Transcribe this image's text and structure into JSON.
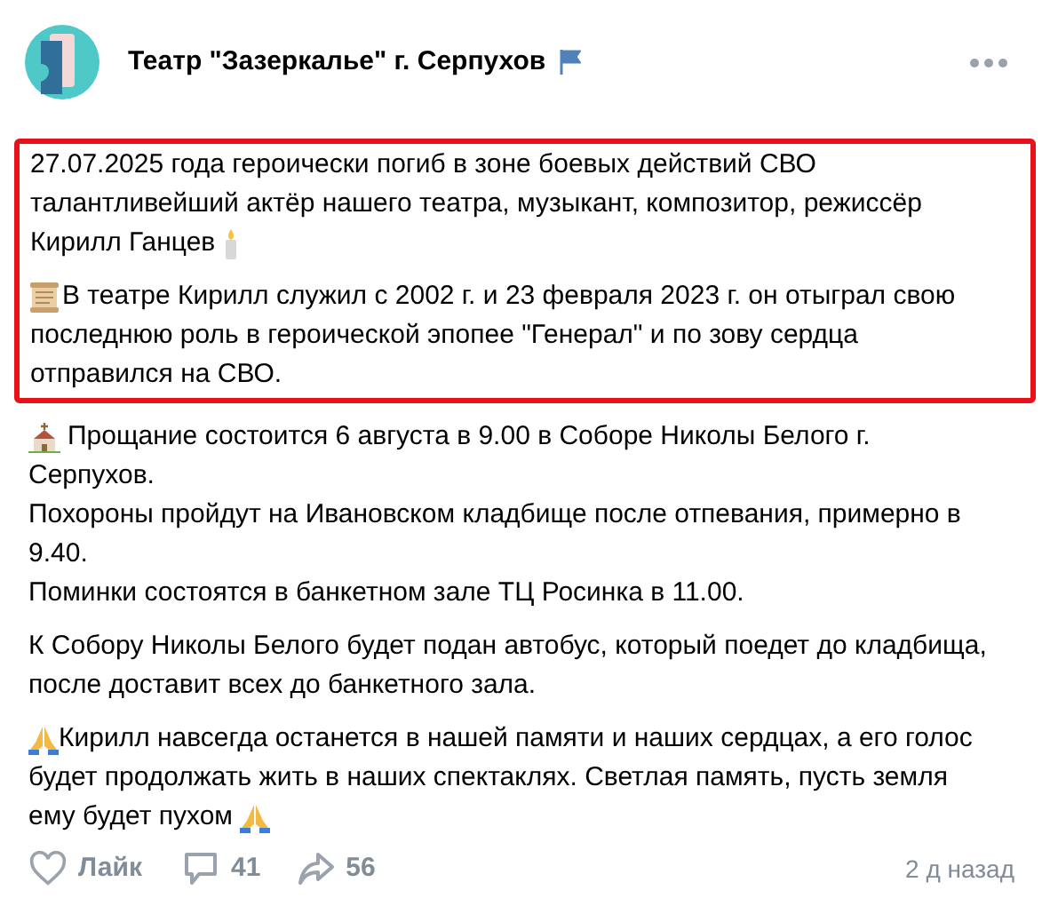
{
  "post": {
    "author": "Театр \"Зазеркалье\" г. Серпухов",
    "highlighted_blocks": [
      {
        "lines": [
          "27.07.2025 года героически погиб в зоне боевых действий СВО",
          "талантливейший актёр нашего театра, музыкант, композитор, режиссёр",
          "Кирилл Ганцев"
        ]
      },
      {
        "lines": [
          "В театре Кирилл служил с 2002 г. и 23 февраля 2023 г. он отыграл свою",
          "последнюю роль в героической эпопее \"Генерал\" и по зову сердца",
          "отправился на СВО."
        ]
      }
    ],
    "blocks": [
      {
        "lines": [
          "Прощание состоится 6 августа в 9.00 в Соборе Николы Белого г.",
          "Серпухов.",
          "Похороны пройдут на Ивановском кладбище после отпевания, примерно в",
          "9.40.",
          "Поминки состоятся в банкетном зале ТЦ Росинка в 11.00."
        ]
      },
      {
        "lines": [
          "К Собору Николы Белого будет подан автобус, который поедет до кладбища,",
          "после доставит всех до банкетного зала."
        ]
      },
      {
        "lines": [
          "Кирилл навсегда останется в нашей памяти и наших сердцах, а его голос",
          "будет продолжать жить в наших спектаклях. Светлая память, пусть земля",
          "ему будет пухом"
        ]
      }
    ]
  },
  "footer": {
    "like": "Лайк",
    "comments": "41",
    "shares": "56",
    "time": "2 д назад"
  }
}
